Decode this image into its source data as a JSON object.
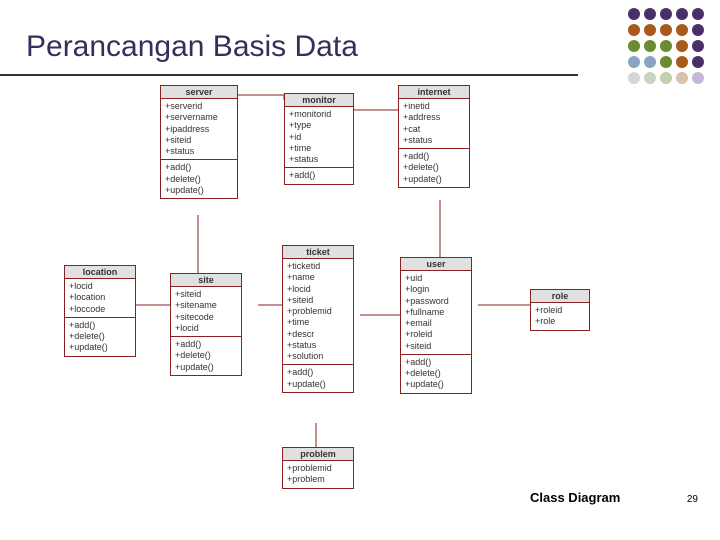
{
  "title": "Perancangan Basis Data",
  "caption": "Class Diagram",
  "page_number": "29",
  "classes": {
    "server": {
      "name": "server",
      "attrs": [
        "+serverid",
        "+servername",
        "+ipaddress",
        "+siteid",
        "+status"
      ],
      "ops": [
        "+add()",
        "+delete()",
        "+update()"
      ]
    },
    "monitor": {
      "name": "monitor",
      "attrs": [
        "+monitorid",
        "+type",
        "+id",
        "+time",
        "+status"
      ],
      "ops": [
        "+add()"
      ]
    },
    "internet": {
      "name": "internet",
      "attrs": [
        "+inetid",
        "+address",
        "+cat",
        "+status"
      ],
      "ops": [
        "+add()",
        "+delete()",
        "+update()"
      ]
    },
    "location": {
      "name": "location",
      "attrs": [
        "+locid",
        "+location",
        "+loccode"
      ],
      "ops": [
        "+add()",
        "+delete()",
        "+update()"
      ]
    },
    "site": {
      "name": "site",
      "attrs": [
        "+siteid",
        "+sitename",
        "+sitecode",
        "+locid"
      ],
      "ops": [
        "+add()",
        "+delete()",
        "+update()"
      ]
    },
    "ticket": {
      "name": "ticket",
      "attrs": [
        "+ticketid",
        "+name",
        "+locid",
        "+siteid",
        "+problemid",
        "+time",
        "+descr",
        "+status",
        "+solution"
      ],
      "ops": [
        "+add()",
        "+update()"
      ]
    },
    "user": {
      "name": "user",
      "attrs": [
        "+uid",
        "+login",
        "+password",
        "+fullname",
        "+email",
        "+roleid",
        "+siteid"
      ],
      "ops": [
        "+add()",
        "+delete()",
        "+update()"
      ]
    },
    "role": {
      "name": "role",
      "attrs": [
        "+roleid",
        "+role"
      ],
      "ops": []
    },
    "problem": {
      "name": "problem",
      "attrs": [
        "+problemid",
        "+problem"
      ],
      "ops": []
    }
  },
  "dot_colors": [
    "#4a2f6b",
    "#4a2f6b",
    "#4a2f6b",
    "#4a2f6b",
    "#4a2f6b",
    "#a85a18",
    "#a85a18",
    "#a85a18",
    "#a85a18",
    "#4a2f6b",
    "#6b8b2f",
    "#6b8b2f",
    "#6b8b2f",
    "#a85a18",
    "#4a2f6b",
    "#8aa3bf",
    "#8aa3bf",
    "#6b8b2f",
    "#a85a18",
    "#4a2f6b",
    "#d6d6d6",
    "#c9d4c2",
    "#c2d0b0",
    "#d8c2a8",
    "#c5b8d6"
  ]
}
